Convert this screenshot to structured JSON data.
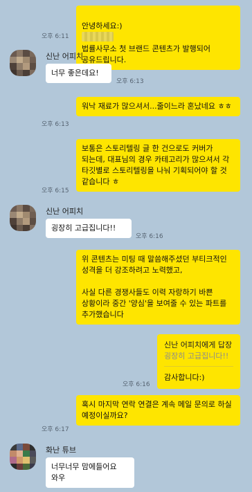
{
  "messages": [
    {
      "id": "m1",
      "from": "me",
      "text_before": "안녕하세요:)",
      "text_after": "법률사무소 첫 브랜드 콘텐츠가 발행되어 공유드립니다.",
      "time": "오후 6:11"
    },
    {
      "id": "m2",
      "from": "other",
      "sender": "신난 어피치",
      "text": "너무 좋은데요!",
      "time": "오후 6:13"
    },
    {
      "id": "m3",
      "from": "me",
      "text": "워낙 재료가 많으셔서...줄이느라 혼났네요 ㅎㅎ",
      "time": "오후 6:13"
    },
    {
      "id": "m4",
      "from": "me",
      "text": "보통은 스토리텔링 글 한 건으로도 커버가 되는데, 대표님의 경우 카테고리가 많으셔서 각 타깃별로 스토리텔링을 나눠 기획되어야 할 것 같습니다 ㅎ",
      "time": "오후 6:15"
    },
    {
      "id": "m5",
      "from": "other",
      "sender": "신난 어피치",
      "text": "굉장히 고급집니다!!",
      "time": "오후 6:16"
    },
    {
      "id": "m6",
      "from": "me",
      "text": "위 콘텐츠는 미팅 때 말씀해주셨던 부티크적인 성격을 더 강조하려고 노력했고,\n\n사실 다른 경쟁사들도 이력 자랑하기 바쁜 상황이라 중간 '양심'을 보여줄 수 있는 파트를 추가했습니다",
      "time": ""
    },
    {
      "id": "m7",
      "from": "me",
      "reply_to": "신난 어피치에게 답장",
      "reply_quote": "굉장히 고급집니다!!",
      "text": "감사합니다:)",
      "time": "오후 6:16"
    },
    {
      "id": "m8",
      "from": "me",
      "text": "혹시 마지막 연락 연결은 계속 메일 문의로 하실 예정이실까요?",
      "time": "오후 6:17"
    },
    {
      "id": "m9",
      "from": "other",
      "sender": "화난 튜브",
      "text": "너무너무 맘에들어요\n와우",
      "time": ""
    }
  ]
}
